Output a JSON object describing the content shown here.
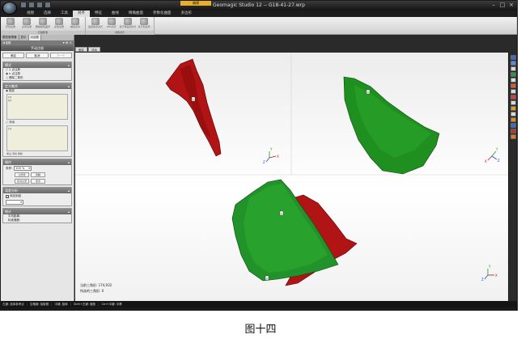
{
  "window": {
    "title": "Geomagic Studio 12 -- G18-41-27.wrp",
    "context_tab": "编辑",
    "controls": [
      "–",
      "□",
      "×"
    ]
  },
  "menu_tabs": [
    "视图",
    "选择",
    "工具",
    "对齐",
    "特征",
    "曲线",
    "精确曲面",
    "参数化曲面",
    "多边形"
  ],
  "active_tab_index": 3,
  "ribbon": {
    "groups": [
      {
        "title": "扫描配准",
        "buttons": [
          "手动注册",
          "全局注册",
          "删除颜色差异",
          "彩色注册",
          "嵌接合并"
        ]
      },
      {
        "title": "对象对齐",
        "buttons": [
          "最佳拟合对齐",
          "RPS对齐",
          "基于特征的对齐",
          "对齐到全局"
        ]
      }
    ]
  },
  "left_panel": {
    "tabs": [
      "模型管理器",
      "显示",
      "对话框"
    ],
    "active_tab_index": 2,
    "title": "对话框",
    "dialog_title": "手动注册",
    "ok": "确定",
    "cancel": "取消",
    "next": "下一个",
    "mode_title": "模式",
    "mode_options": [
      "1 点注册",
      "n 点注册",
      "删除二条形"
    ],
    "define_set_title": "定义集合",
    "fixed_label": "固定",
    "fixed_items": [
      "[1]",
      "[2]"
    ],
    "float_label": "浮动",
    "float_items": [
      "[1]"
    ],
    "list_tools": "重设  添加  删除",
    "ops_title": "操作",
    "sampling_label": "采样:",
    "sampling_value": "100 %",
    "btn_register": "注册器",
    "btn_clear": "清除",
    "btn_undo": "取消注册",
    "btn_reset": "重置",
    "compare_title": "误差分析",
    "compare_check": "添加到组",
    "stats_title": "统计",
    "stats_avg": "平均距离:",
    "stats_std": "标准偏差:"
  },
  "view_tabs": [
    "固定",
    "浮动"
  ],
  "viewport_info": {
    "total_triangles": "当前三角形: 174,932",
    "selected_triangles": "所选的三角形: 0"
  },
  "status_bar": [
    "左键: 选择参考点",
    "空格键: 拾取框",
    "中键: 旋转",
    "Shift+左键: 缩放",
    "Ctrl+中键: 平移"
  ],
  "axis_labels": {
    "x": "X",
    "y": "Y",
    "z": "Z"
  },
  "point_markers": [
    "1",
    "1",
    "1",
    "1"
  ],
  "colors": {
    "fixed_mesh": "#1f8f1f",
    "float_mesh": "#b01212",
    "ribbon": "#d8d8d8",
    "titlebar": "#1c1c1c"
  },
  "caption": "图十四"
}
